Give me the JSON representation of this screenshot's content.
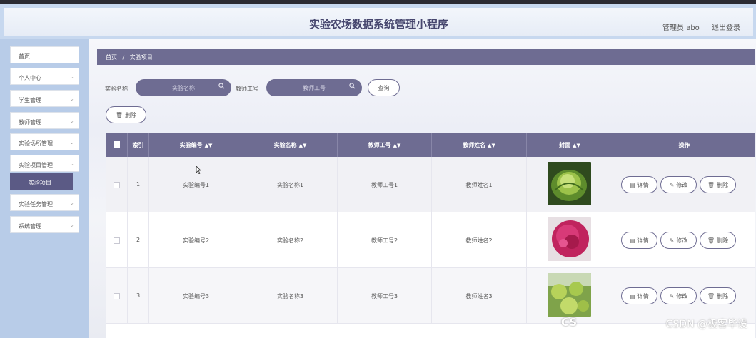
{
  "header": {
    "title": "实验农场数据系统管理小程序",
    "user": "管理员 abo",
    "logout": "退出登录"
  },
  "sidebar": {
    "items": [
      {
        "label": "首页",
        "expandable": false
      },
      {
        "label": "个人中心",
        "expandable": true
      },
      {
        "label": "学生管理",
        "expandable": true
      },
      {
        "label": "教师管理",
        "expandable": true
      },
      {
        "label": "实验场所管理",
        "expandable": true
      },
      {
        "label": "实验项目管理",
        "expandable": true
      },
      {
        "label": "实验任务管理",
        "expandable": true
      },
      {
        "label": "系统管理",
        "expandable": true
      }
    ],
    "active_sub": "实验项目"
  },
  "breadcrumb": {
    "home": "首页",
    "separator": "/",
    "current": "实验项目"
  },
  "search": {
    "name_label": "实验名称",
    "name_placeholder": "实验名称",
    "teacher_label": "教师工号",
    "teacher_placeholder": "教师工号",
    "query_button": "查询"
  },
  "toolbar": {
    "delete_label": "删除"
  },
  "table": {
    "columns": [
      "索引",
      "实验编号",
      "实验名称",
      "教师工号",
      "教师姓名",
      "封面",
      "操作"
    ],
    "rows": [
      {
        "index": "1",
        "code": "实验编号1",
        "name": "实验名称1",
        "teacher_id": "教师工号1",
        "teacher_name": "教师姓名1",
        "cover": "cabbage"
      },
      {
        "index": "2",
        "code": "实验编号2",
        "name": "实验名称2",
        "teacher_id": "教师工号2",
        "teacher_name": "教师姓名2",
        "cover": "pink-flower"
      },
      {
        "index": "3",
        "code": "实验编号3",
        "name": "实验名称3",
        "teacher_id": "教师工号3",
        "teacher_name": "教师姓名3",
        "cover": "green-fruit"
      }
    ],
    "actions": {
      "detail": "详情",
      "edit": "修改",
      "delete": "删除"
    }
  },
  "watermark": {
    "left": "CS",
    "right": "CSDN @极客毕设"
  },
  "colors": {
    "accent": "#6e6c92",
    "sidebar_bg": "#b8cce8",
    "header_bg": "#c7d8ef"
  }
}
